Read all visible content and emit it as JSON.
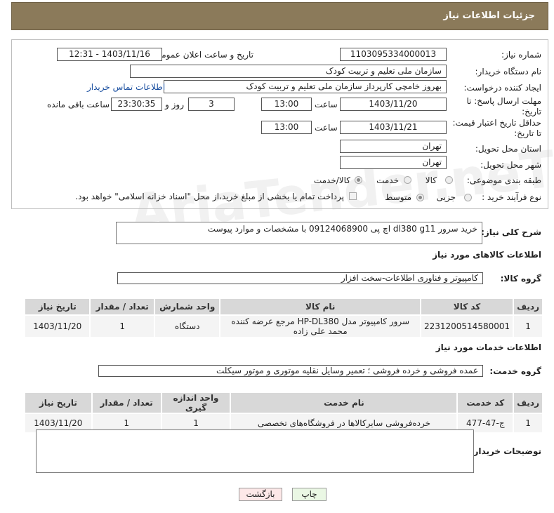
{
  "header": {
    "title": "جزئیات اطلاعات نیاز"
  },
  "form": {
    "need_number": {
      "label": "شماره نیاز:",
      "value": "1103095334000013"
    },
    "announce_datetime": {
      "label": "تاریخ و ساعت اعلان عمومی:",
      "value": "1403/11/16 - 12:31"
    },
    "buyer_org": {
      "label": "نام دستگاه خریدار:",
      "value": "سازمان ملی تعلیم و تربیت کودک"
    },
    "requester": {
      "label": "ایجاد کننده درخواست:",
      "value": "بهروز خامچی کارپرداز سازمان ملی تعلیم و تربیت کودک",
      "contact_link": "اطلاعات تماس خریدار"
    },
    "reply_deadline": {
      "label": "مهلت ارسال پاسخ: تا تاریخ:",
      "date": "1403/11/20",
      "time_label": "ساعت",
      "time": "13:00",
      "days": "3",
      "days_label": "روز و",
      "remaining": "23:30:35",
      "remaining_label": "ساعت باقی مانده"
    },
    "price_validity": {
      "label": "حداقل تاریخ اعتبار قیمت: تا تاریخ:",
      "date": "1403/11/21",
      "time_label": "ساعت",
      "time": "13:00"
    },
    "province": {
      "label": "استان محل تحویل:",
      "value": "تهران"
    },
    "city": {
      "label": "شهر محل تحویل:",
      "value": "تهران"
    },
    "category": {
      "label": "طبقه بندی موضوعی:",
      "options": [
        "کالا",
        "خدمت",
        "کالا/خدمت"
      ]
    },
    "process": {
      "label": "نوع فرآیند خرید :",
      "options": [
        "جزیی",
        "متوسط"
      ],
      "payment_note": "پرداخت تمام یا بخشی از مبلغ خرید،از محل \"اسناد خزانه اسلامی\" خواهد بود."
    }
  },
  "description": {
    "label": "شرح کلی نیاز:",
    "value": "خرید سرور dl380 g11 اچ پی 09124068900 با مشخصات و موارد پیوست"
  },
  "goods": {
    "title": "اطلاعات کالاهای مورد نیاز",
    "group_label": "گروه کالا:",
    "group_value": "کامپیوتر و فناوری اطلاعات-سخت افزار",
    "headers": [
      "ردیف",
      "کد کالا",
      "نام کالا",
      "واحد شمارش",
      "تعداد / مقدار",
      "تاریخ نیاز"
    ],
    "rows": [
      {
        "row": "1",
        "code": "2231200514580001",
        "name": "سرور کامپیوتر مدل HP-DL380 مرجع عرضه کننده محمد علی زاده",
        "unit": "دستگاه",
        "qty": "1",
        "date": "1403/11/20"
      }
    ]
  },
  "services": {
    "title": "اطلاعات خدمات مورد نیاز",
    "group_label": "گروه خدمت:",
    "group_value": "عمده فروشی و خرده فروشی ؛ تعمیر وسایل نقلیه موتوری و موتور سیکلت",
    "headers": [
      "ردیف",
      "کد خدمت",
      "نام خدمت",
      "واحد اندازه گیری",
      "تعداد / مقدار",
      "تاریخ نیاز"
    ],
    "rows": [
      {
        "row": "1",
        "code": "ج-47-477",
        "name": "خرده‌فروشی سایرکالاها در فروشگاه‌های تخصصی",
        "unit": "1",
        "qty": "1",
        "date": "1403/11/20"
      }
    ]
  },
  "buyer_notes": {
    "label": "توضیحات خریدار:",
    "value": ""
  },
  "buttons": {
    "print": "چاپ",
    "back": "بازگشت"
  },
  "watermark": "AriaTender.neT",
  "colors": {
    "header_bg": "#8b7a5a",
    "link": "#1a4fa0",
    "back_button_bg": "#fde8e8",
    "print_button_bg": "#eaf7e4"
  }
}
